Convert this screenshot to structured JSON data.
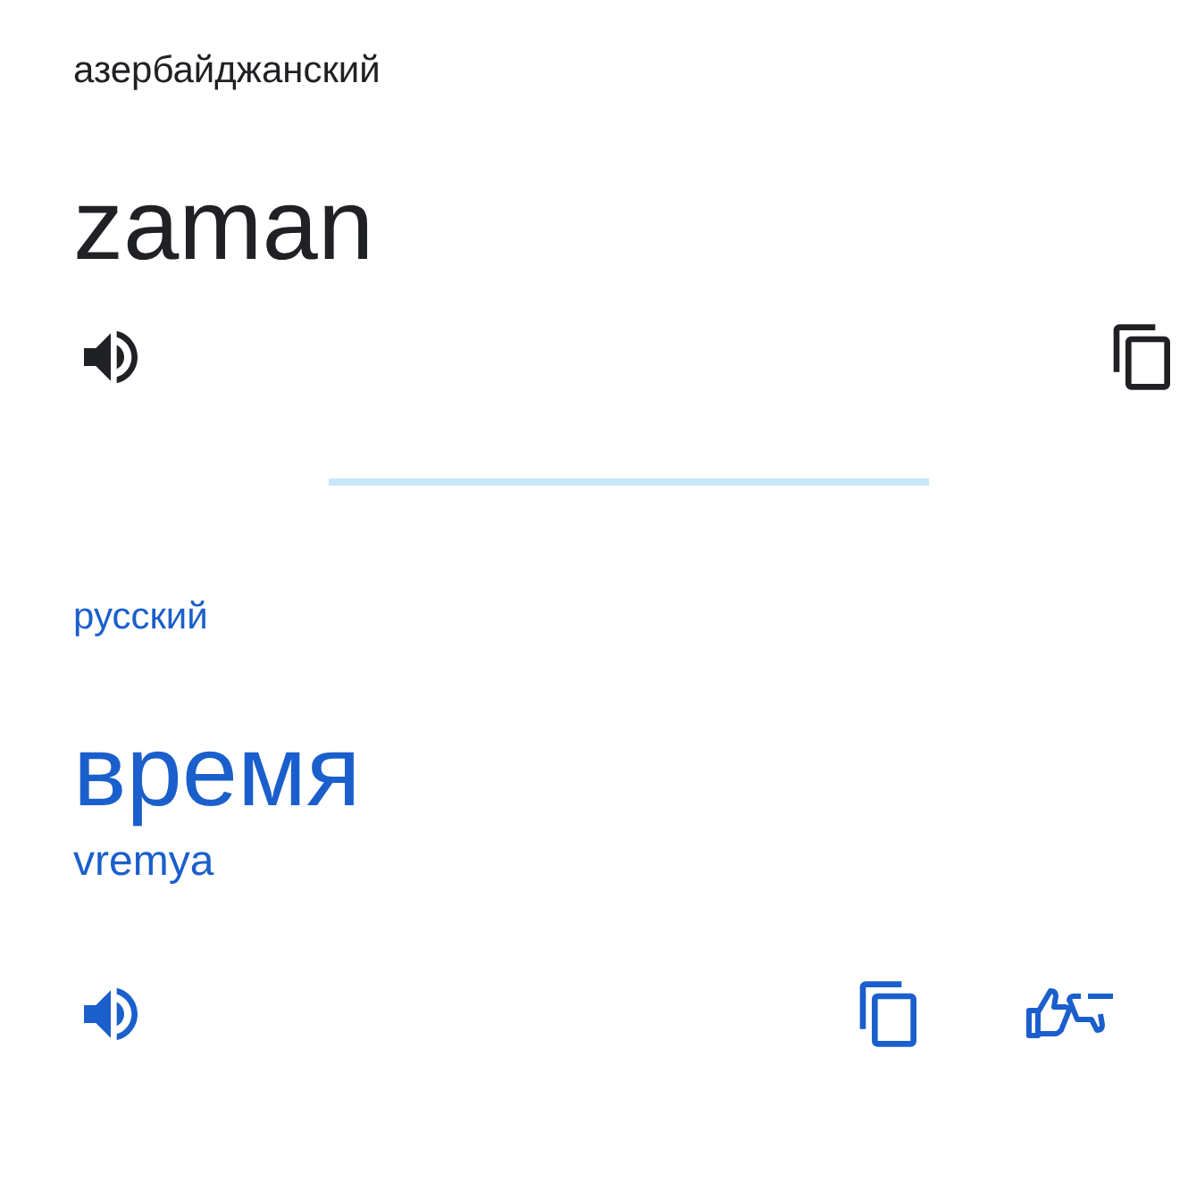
{
  "source": {
    "language": "азербайджанский",
    "text": "zaman"
  },
  "target": {
    "language": "русский",
    "text": "время",
    "transliteration": "vremya"
  }
}
